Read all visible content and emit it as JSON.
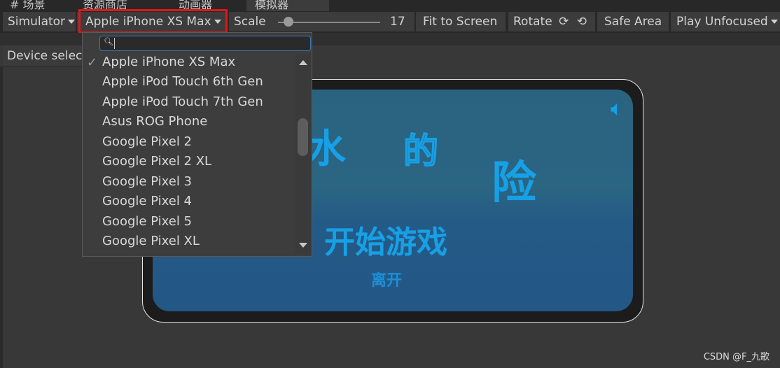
{
  "tabs": [
    {
      "label": "# 场景"
    },
    {
      "label": "资源商店"
    },
    {
      "label": "动画器"
    },
    {
      "label": "模拟器"
    }
  ],
  "toolbar": {
    "simulator": "Simulator",
    "device": "Apple iPhone XS Max",
    "scale_label": "Scale",
    "scale_value": "17",
    "fit": "Fit to Screen",
    "rotate": "Rotate",
    "safe_area": "Safe Area",
    "play_mode": "Play Unfocused"
  },
  "panel": {
    "device_selector": "Device selec"
  },
  "dropdown": {
    "search_value": "",
    "selected": "Apple iPhone XS Max",
    "items": [
      "Apple iPhone XS Max",
      "Apple iPod Touch 6th Gen",
      "Apple iPod Touch 7th Gen",
      "Asus ROG Phone",
      "Google Pixel 2",
      "Google Pixel 2 XL",
      "Google Pixel 3",
      "Google Pixel 4",
      "Google Pixel 5",
      "Google Pixel XL"
    ]
  },
  "game": {
    "title_chars": [
      "水",
      "的",
      "险"
    ],
    "start": "开始游戏",
    "exit": "离开"
  },
  "watermark": "CSDN @F_九歌",
  "colors": {
    "highlight": "#e0161b",
    "accent": "#17a0e6",
    "search_border": "#3a79bb"
  }
}
